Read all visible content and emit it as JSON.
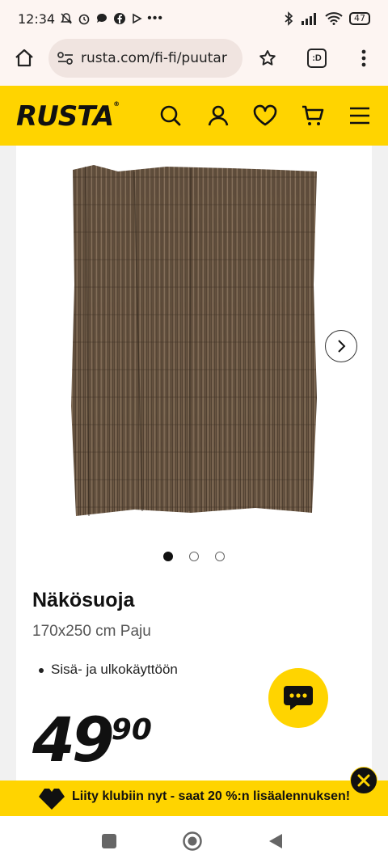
{
  "status_bar": {
    "time": "12:34",
    "notification_icons": [
      "bell-off-icon",
      "alarm-icon",
      "chat-bubble-icon",
      "facebook-icon",
      "play-icon",
      "more-dots-icon"
    ],
    "right_icons": [
      "bluetooth-icon",
      "signal-icon",
      "wifi-icon"
    ],
    "battery_level": "47"
  },
  "browser": {
    "url": "rusta.com/fi-fi/puutar",
    "tab_label": ":D"
  },
  "site": {
    "logo": "RUSTA",
    "logo_mark": "®",
    "accent_color": "#ffd400"
  },
  "product": {
    "name": "Näkösuoja",
    "subtitle": "170x250 cm Paju",
    "bullets": [
      "Sisä- ja ulkokäyttöön"
    ],
    "price_main": "49",
    "price_decimal": "90",
    "image_count": 3,
    "active_image_index": 0
  },
  "banner": {
    "text": "Liity klubiin nyt - saat 20 %:n lisäalennuksen!"
  }
}
